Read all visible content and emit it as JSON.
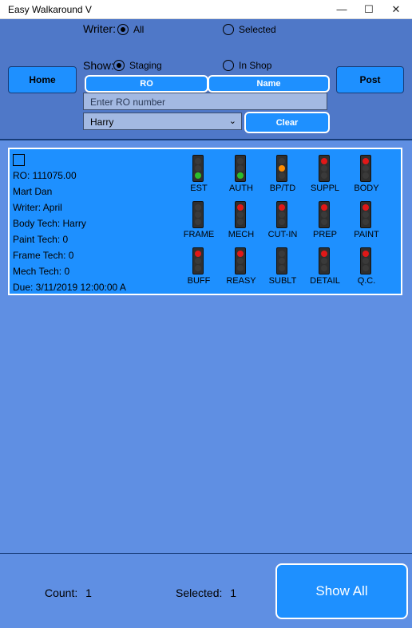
{
  "window": {
    "title": "Easy Walkaround V",
    "minimize": "—",
    "maximize": "☐",
    "close": "✕"
  },
  "filters": {
    "writer_label": "Writer:",
    "writer_options": [
      {
        "label": "All",
        "selected": true
      },
      {
        "label": "Selected",
        "selected": false
      }
    ],
    "show_label": "Show:",
    "show_options": [
      {
        "label": "Staging",
        "selected": true
      },
      {
        "label": "In Shop",
        "selected": false
      }
    ]
  },
  "buttons": {
    "home": "Home",
    "post": "Post",
    "ro": "RO",
    "name": "Name",
    "clear": "Clear",
    "show_all": "Show All"
  },
  "search": {
    "placeholder": "Enter RO number",
    "value": ""
  },
  "tech_select": {
    "selected": "Harry"
  },
  "card": {
    "checked": false,
    "lines": [
      "RO:  111075.00",
      "Mart Dan",
      "Writer:  April",
      "Body Tech:  Harry",
      "Paint Tech:  0",
      "Frame Tech:  0",
      "Mech Tech:  0",
      "Due:  3/11/2019 12:00:00 A"
    ],
    "lights": [
      {
        "label": "EST",
        "status": "green"
      },
      {
        "label": "AUTH",
        "status": "green"
      },
      {
        "label": "BP/TD",
        "status": "yellow"
      },
      {
        "label": "SUPPL",
        "status": "red"
      },
      {
        "label": "BODY",
        "status": "red"
      },
      {
        "label": "FRAME",
        "status": "off"
      },
      {
        "label": "MECH",
        "status": "red"
      },
      {
        "label": "CUT-IN",
        "status": "red"
      },
      {
        "label": "PREP",
        "status": "red"
      },
      {
        "label": "PAINT",
        "status": "red"
      },
      {
        "label": "BUFF",
        "status": "red"
      },
      {
        "label": "REASY",
        "status": "red"
      },
      {
        "label": "SUBLT",
        "status": "off"
      },
      {
        "label": "DETAIL",
        "status": "red"
      },
      {
        "label": "Q.C.",
        "status": "red"
      }
    ]
  },
  "footer": {
    "count_label": "Count:",
    "count_value": "1",
    "selected_label": "Selected:",
    "selected_value": "1"
  },
  "colors": {
    "red": "#e01818",
    "green": "#2bbd2b",
    "yellow": "#ff8c00",
    "off": "#3a3a3a"
  }
}
